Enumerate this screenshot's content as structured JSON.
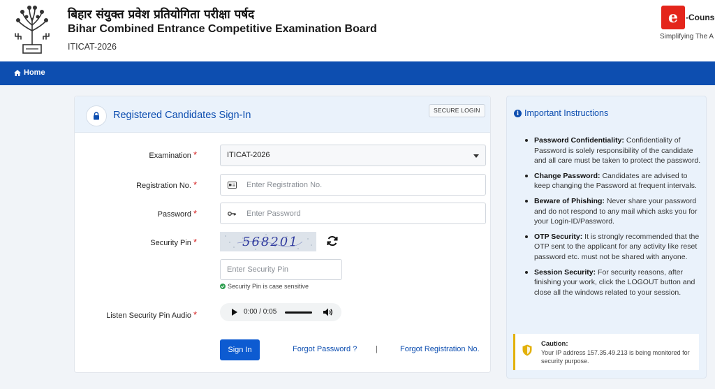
{
  "header": {
    "hindi_title": "बिहार संयुक्त प्रवेश प्रतियोगिता परीक्षा पर्षद",
    "board_name": "Bihar Combined Entrance Competitive Examination Board",
    "exam_code": "ITICAT-2026",
    "brand_logo_letter": "e",
    "brand_name": "-Counse",
    "brand_tagline": "Simplifying The A"
  },
  "nav": {
    "home_label": "Home"
  },
  "signin": {
    "title": "Registered Candidates Sign-In",
    "badge": "SECURE LOGIN",
    "examination_label": "Examination",
    "examination_value": "ITICAT-2026",
    "registration_label": "Registration No.",
    "registration_placeholder": "Enter Registration No.",
    "password_label": "Password",
    "password_placeholder": "Enter Password",
    "security_pin_label": "Security Pin",
    "captcha_text": "568201",
    "security_pin_placeholder": "Enter Security Pin",
    "pin_note": "Security Pin is case sensitive",
    "audio_label": "Listen Security Pin Audio",
    "audio_time": "0:00 / 0:05",
    "required_mark": "*",
    "signin_button": "Sign In",
    "forgot_password": "Forgot Password ?",
    "separator": "|",
    "forgot_registration": "Forgot Registration No."
  },
  "instructions": {
    "title": "Important Instructions",
    "items": [
      {
        "heading": "Password Confidentiality:",
        "text": " Confidentiality of Password is solely responsibility of the candidate and all care must be taken to protect the password."
      },
      {
        "heading": "Change Password:",
        "text": " Candidates are advised to keep changing the Password at frequent intervals."
      },
      {
        "heading": "Beware of Phishing:",
        "text": " Never share your password and do not respond to any mail which asks you for your Login-ID/Password."
      },
      {
        "heading": "OTP Security:",
        "text": " It is strongly recommended that the OTP sent to the applicant for any activity like reset password etc. must not be shared with anyone."
      },
      {
        "heading": "Session Security:",
        "text": " For security reasons, after finishing your work, click the LOGOUT button and close all the windows related to your session."
      }
    ],
    "caution_title": "Caution:",
    "caution_text": "Your IP address 157.35.49.213 is being monitored for security purpose."
  },
  "colors": {
    "primary": "#0d4eb0",
    "nav": "#0d4eb0",
    "brand_red": "#e4251b",
    "required": "#d62020",
    "caution_accent": "#e3b10b",
    "success": "#2e9e4f"
  },
  "icons": [
    "emblem-icon",
    "home-icon",
    "lock-icon",
    "id-card-icon",
    "key-icon",
    "refresh-icon",
    "check-circle-icon",
    "play-icon",
    "volume-icon",
    "info-icon",
    "shield-icon"
  ]
}
